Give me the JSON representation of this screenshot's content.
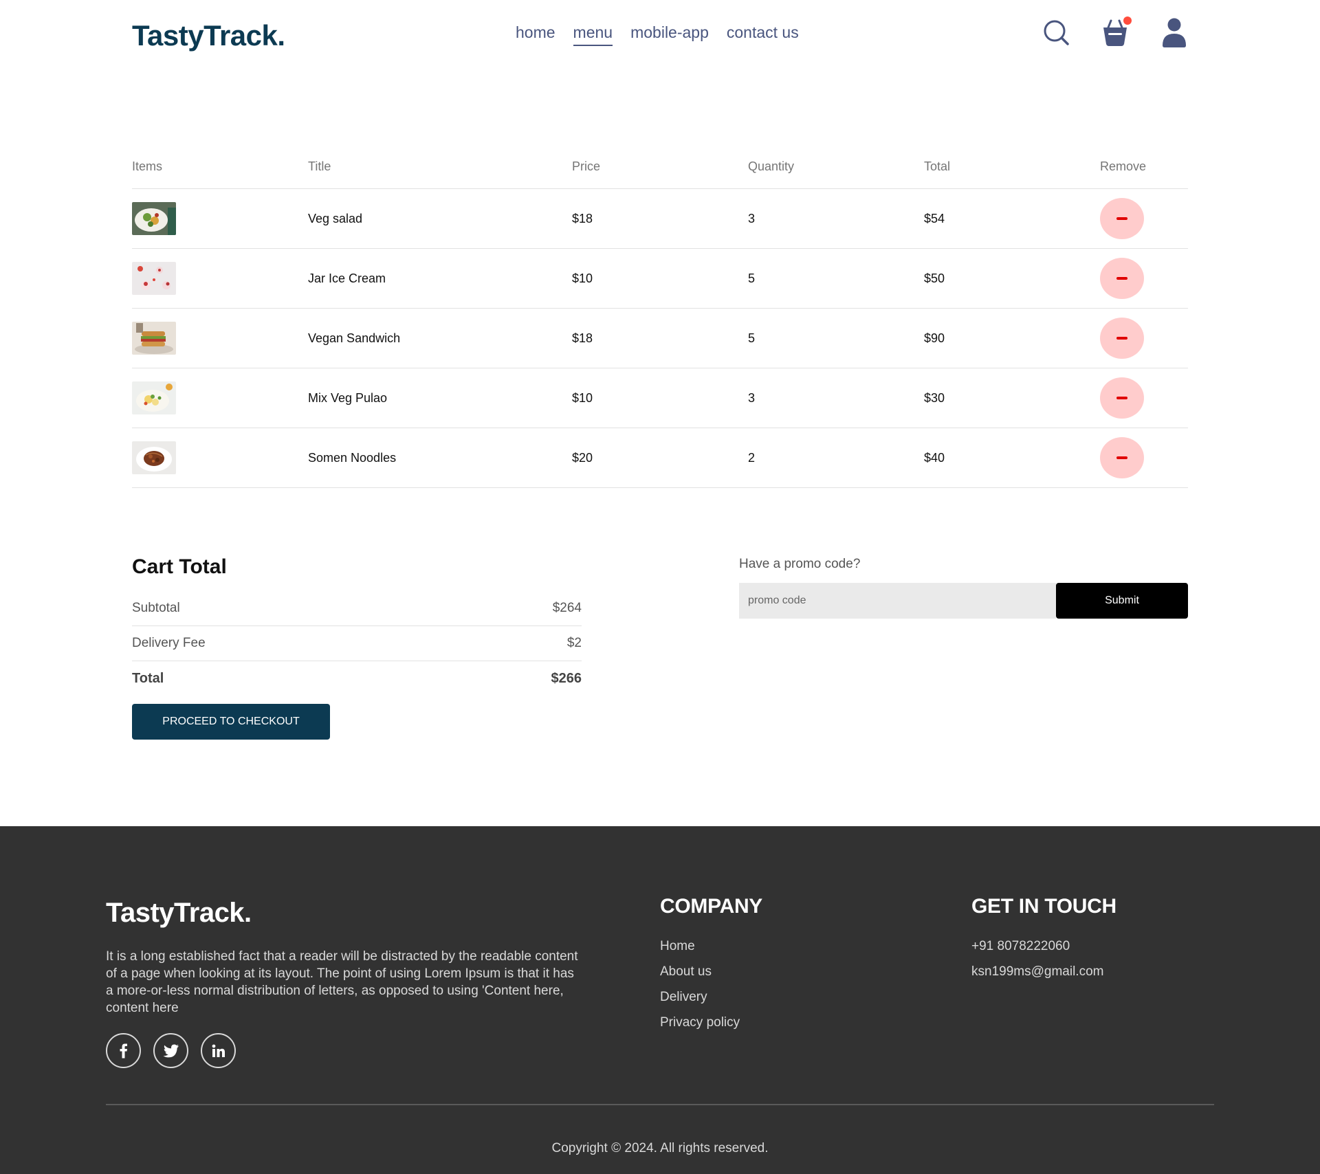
{
  "navbar": {
    "logo": "TastyTrack.",
    "menu": [
      "home",
      "menu",
      "mobile-app",
      "contact us"
    ],
    "active_index": 1,
    "cart_has_items": true
  },
  "cart": {
    "headers": [
      "Items",
      "Title",
      "Price",
      "Quantity",
      "Total",
      "Remove"
    ],
    "items": [
      {
        "title": "Veg salad",
        "price": "$18",
        "quantity": "3",
        "total": "$54",
        "image": "veg-salad-image"
      },
      {
        "title": "Jar Ice Cream",
        "price": "$10",
        "quantity": "5",
        "total": "$50",
        "image": "jar-ice-cream-image"
      },
      {
        "title": "Vegan Sandwich",
        "price": "$18",
        "quantity": "5",
        "total": "$90",
        "image": "vegan-sandwich-image"
      },
      {
        "title": "Mix Veg Pulao",
        "price": "$10",
        "quantity": "3",
        "total": "$30",
        "image": "mix-veg-pulao-image"
      },
      {
        "title": "Somen Noodles",
        "price": "$20",
        "quantity": "2",
        "total": "$40",
        "image": "somen-noodles-image"
      }
    ]
  },
  "cart_total": {
    "heading": "Cart Total",
    "subtotal_label": "Subtotal",
    "subtotal_value": "$264",
    "delivery_label": "Delivery Fee",
    "delivery_value": "$2",
    "total_label": "Total",
    "total_value": "$266",
    "checkout_label": "PROCEED TO CHECKOUT"
  },
  "promo": {
    "prompt": "Have a promo code?",
    "placeholder": "promo code",
    "submit_label": "Submit"
  },
  "footer": {
    "logo": "TastyTrack.",
    "description": "It is a long established fact that a reader will be distracted by the readable content of a page when looking at its layout. The point of using Lorem Ipsum is that it has a more-or-less normal distribution of letters, as opposed to using 'Content here, content here",
    "socials": [
      "facebook-icon",
      "twitter-icon",
      "linkedin-icon"
    ],
    "company_heading": "COMPANY",
    "company_links": [
      "Home",
      "About us",
      "Delivery",
      "Privacy policy"
    ],
    "contact_heading": "GET IN TOUCH",
    "phone": "+91 8078222060",
    "email": "ksn199ms@gmail.com",
    "copyright": "Copyright © 2024. All rights reserved."
  },
  "colors": {
    "brand": "#0c3a52",
    "nav_text": "#49557e",
    "remove_bg": "#ffcccc",
    "remove_icon": "#e00000",
    "footer_bg": "#323232",
    "cart_dot": "#ff4d3d"
  }
}
